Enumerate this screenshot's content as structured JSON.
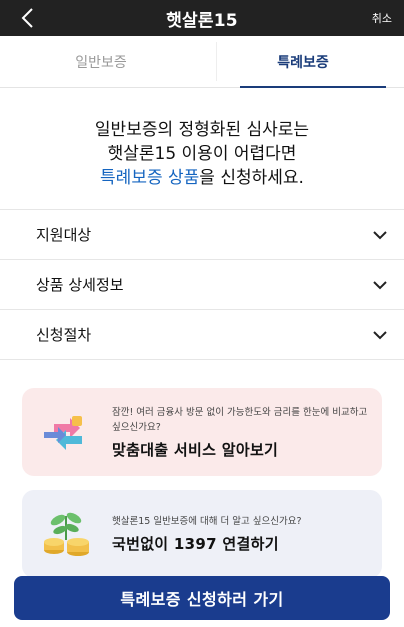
{
  "header": {
    "title": "햇살론15",
    "cancel_label": "취소"
  },
  "tabs": [
    {
      "label": "일반보증",
      "active": false
    },
    {
      "label": "특례보증",
      "active": true
    }
  ],
  "intro": {
    "line1": "일반보증의 정형화된 심사로는",
    "line2": "햇살론15 이용이 어렵다면",
    "line3_highlight": "특례보증 상품",
    "line3_rest": "을 신청하세요."
  },
  "accordion": [
    {
      "label": "지원대상"
    },
    {
      "label": "상품 상세정보"
    },
    {
      "label": "신청절차"
    }
  ],
  "cards": {
    "match_loan": {
      "desc": "잠깐! 여러 금융사 방문 없이 가능한도와 금리를 한눈에 비교하고 싶으신가요?",
      "title": "맞춤대출 서비스 알아보기"
    },
    "call": {
      "desc": "햇살론15 일반보증에 대해 더 알고 싶으신가요?",
      "title": "국번없이 1397 연결하기"
    }
  },
  "cta_label": "특례보증 신청하러 가기",
  "colors": {
    "header_bg": "#222222",
    "accent": "#1a3c8e",
    "highlight": "#1565c0",
    "pink_card": "#fbeaea",
    "blue_card": "#eef0f7"
  }
}
